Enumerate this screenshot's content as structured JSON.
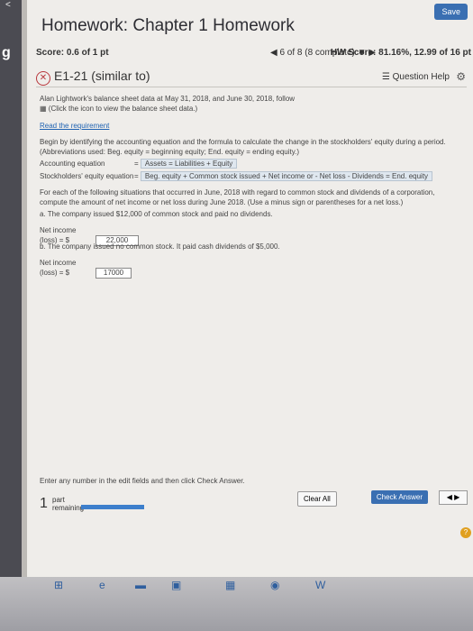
{
  "sidebar": {
    "logo": "g",
    "chevron": "<"
  },
  "header": {
    "title": "Homework: Chapter 1 Homework",
    "save_label": "Save"
  },
  "status": {
    "score": "Score: 0.6 of 1 pt",
    "nav": "6 of 8 (8 complete)",
    "hw_score": "HW Score: 81.16%, 12.99 of 16 pt"
  },
  "question": {
    "title": "E1-21 (similar to)",
    "help_label": "Question Help"
  },
  "content": {
    "intro1": "Alan Lightwork's balance sheet data at May 31, 2018, and June 30, 2018, follow",
    "intro2": "(Click the icon to view the balance sheet data.)",
    "read_label": "Read the requirement",
    "instr": "Begin by identifying the accounting equation and the formula to calculate the change in the stockholders' equity during a period. (Abbreviations used: Beg. equity = beginning equity; End. equity = ending equity.)",
    "acc_label": "Accounting equation",
    "acc_eq": "Assets = Liabilities + Equity",
    "se_label": "Stockholders' equity equation",
    "se_eq": "Beg. equity + Common stock issued + Net income or - Net loss - Dividends = End. equity",
    "instr2": "For each of the following situations that occurred in June, 2018 with regard to common stock and dividends of a corporation, compute the amount of net income or net loss during June 2018. (Use a minus sign or parentheses for a net loss.)",
    "a_text": "a. The company issued $12,000 of common stock and paid no dividends.",
    "a_label": "Net income (loss) = $",
    "a_value": "22,000",
    "b_text": "b. The company issued no common stock. It paid cash dividends of $5,000.",
    "b_label": "Net income (loss) = $",
    "b_value": "17000",
    "enter": "Enter any number in the edit fields and then click Check Answer."
  },
  "footer": {
    "parts_count": "1",
    "parts_label1": "part",
    "parts_label2": "remaining",
    "progress": 1.0,
    "clear_label": "Clear All",
    "check_label": "Check Answer",
    "help_label": "?"
  }
}
